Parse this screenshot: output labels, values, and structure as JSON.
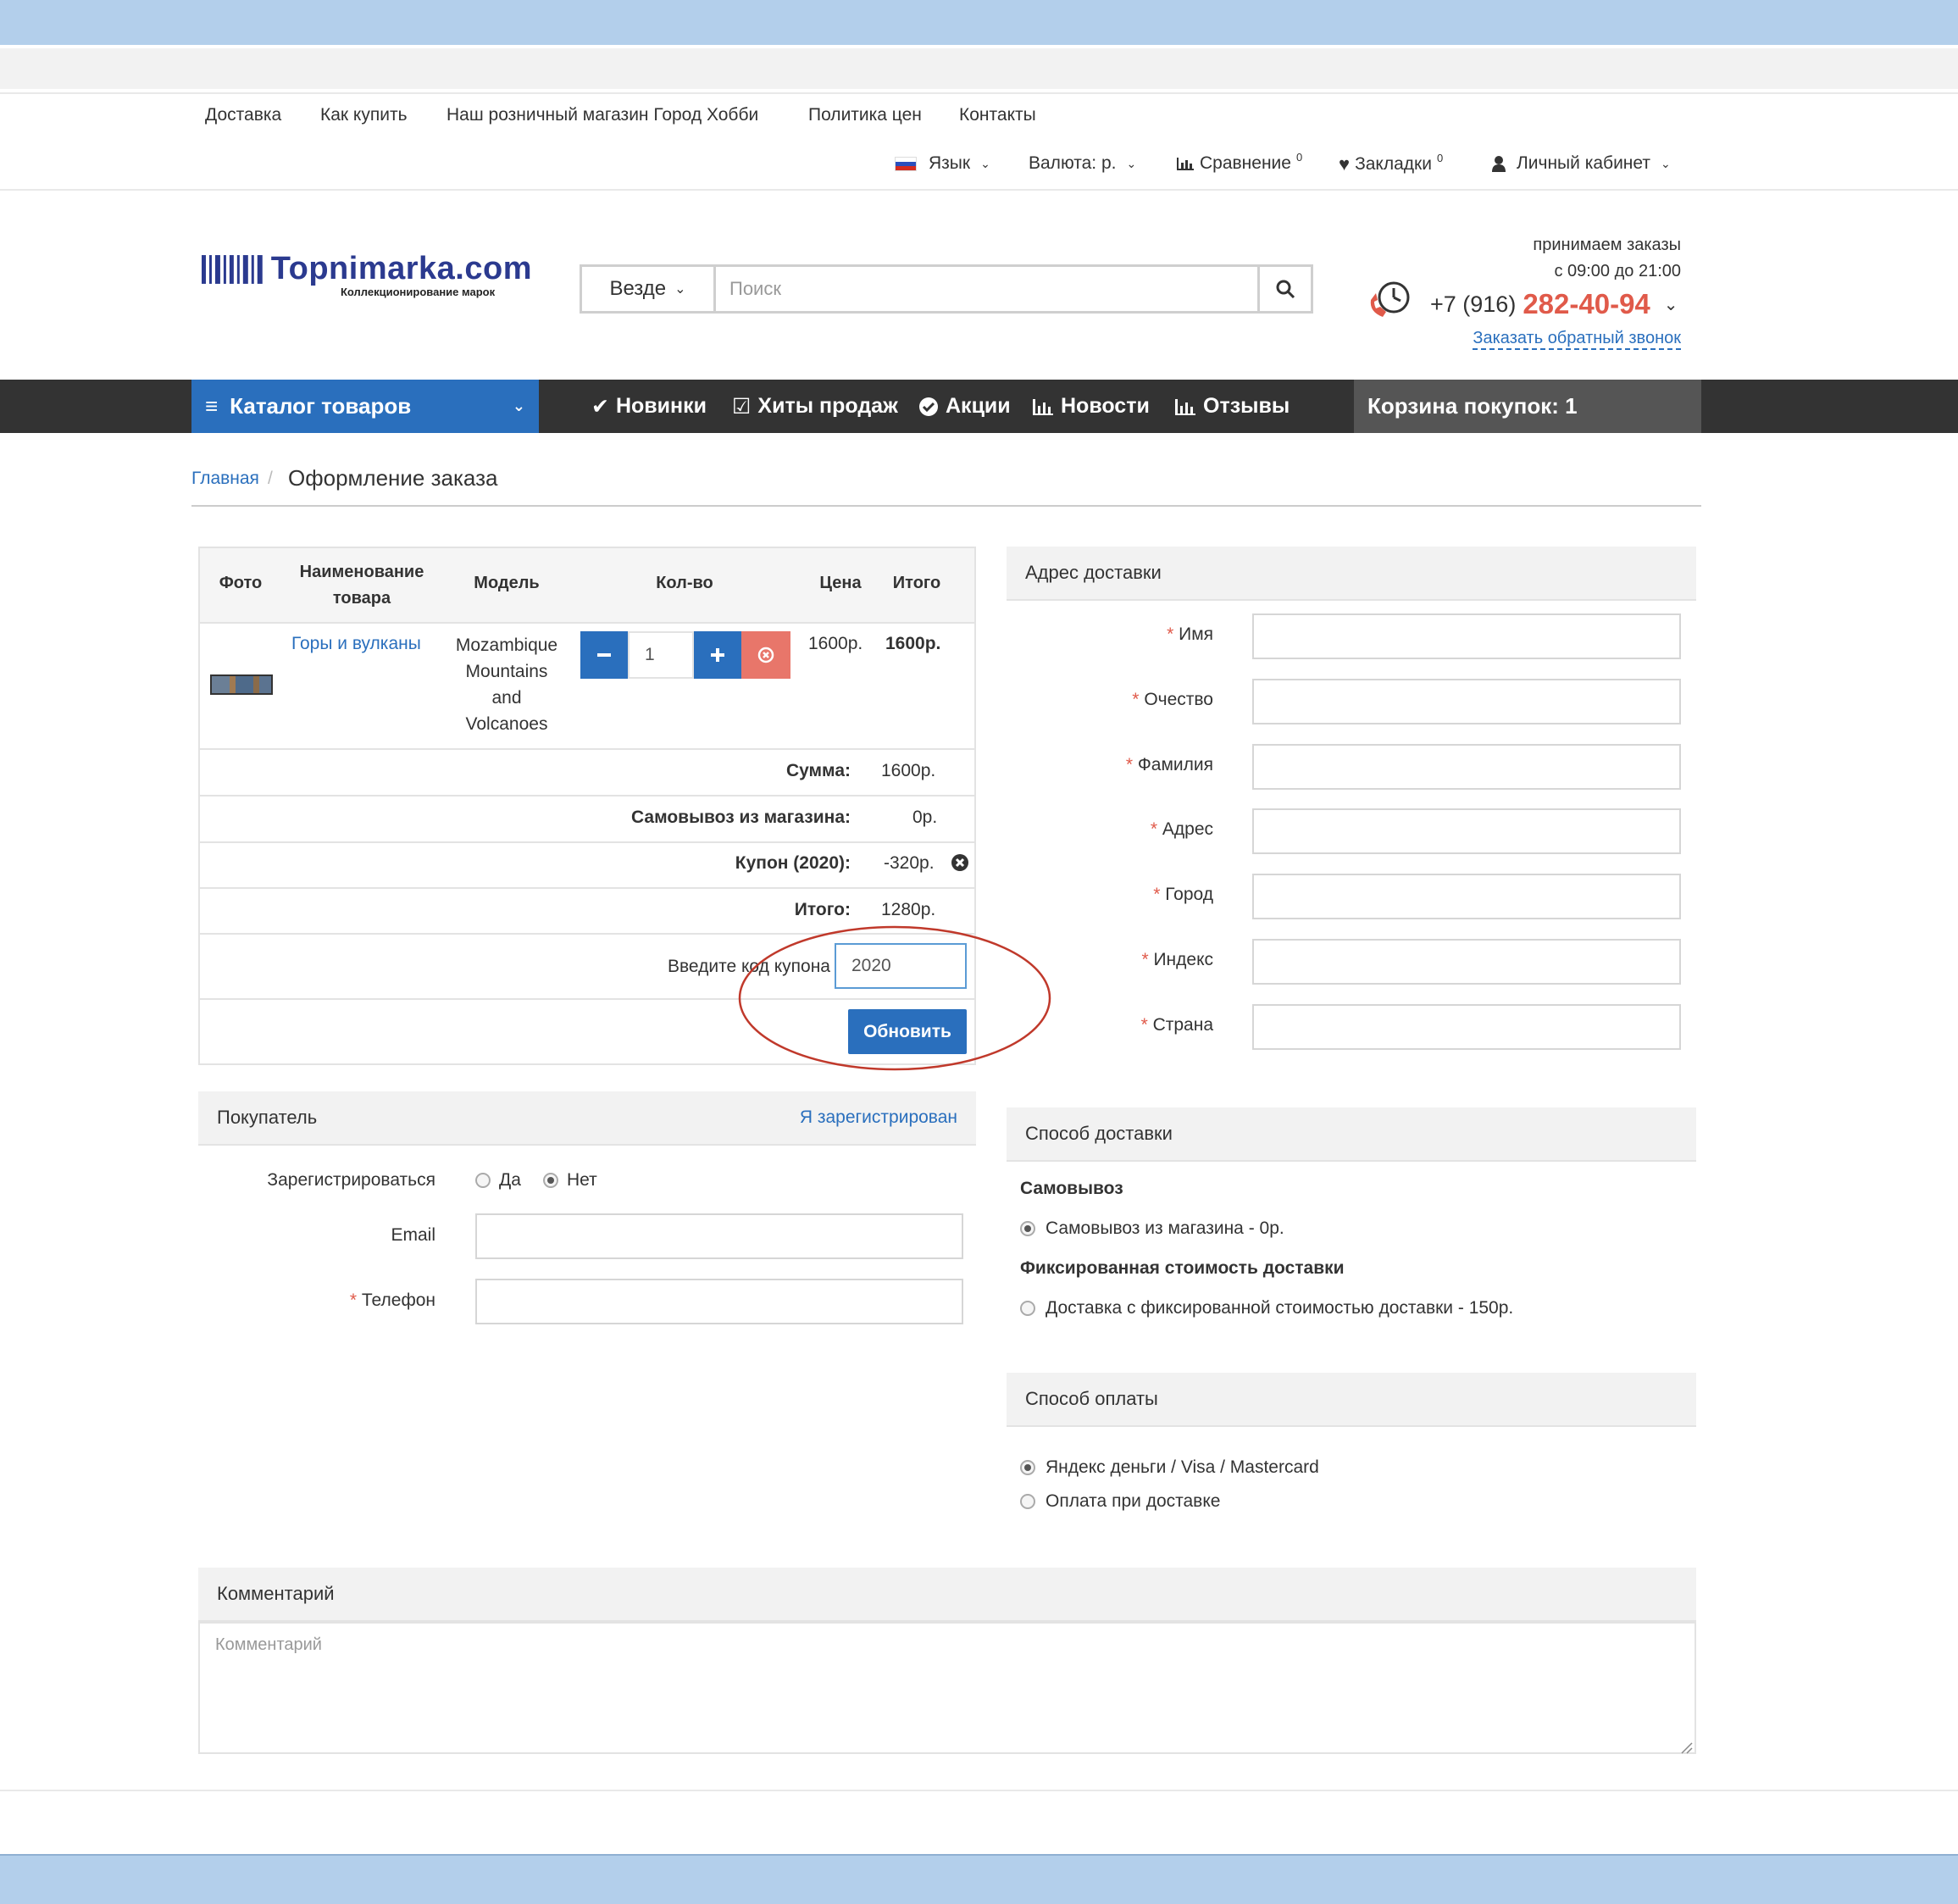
{
  "top_nav": [
    "Доставка",
    "Как купить",
    "Наш розничный магазин Город Хобби",
    "Политика цен",
    "Контакты"
  ],
  "toolbar": {
    "language": "Язык",
    "currency": "Валюта: р.",
    "compare": "Сравнение",
    "compare_count": "0",
    "bookmarks": "Закладки",
    "bookmarks_count": "0",
    "account": "Личный кабинет"
  },
  "logo": {
    "name": "Topnimarka.com",
    "tagline": "Коллекционирование марок"
  },
  "search": {
    "scope": "Везде",
    "placeholder": "Поиск"
  },
  "contact": {
    "line1": "принимаем заказы",
    "line2": "с 09:00 до 21:00",
    "phone_prefix": "+7 (916)",
    "phone_main": "282-40-94",
    "callback": "Заказать обратный звонок"
  },
  "main_nav": {
    "catalog": "Каталог товаров",
    "items": [
      "Новинки",
      "Хиты продаж",
      "Акции",
      "Новости",
      "Отзывы"
    ],
    "cart": "Корзина покупок: 1"
  },
  "breadcrumb": {
    "home": "Главная",
    "sep": "/",
    "current": "Оформление заказа"
  },
  "cart_table": {
    "headers": {
      "photo": "Фото",
      "name": "Наименование товара",
      "model": "Модель",
      "qty": "Кол-во",
      "price": "Цена",
      "total": "Итого"
    },
    "item": {
      "name": "Горы и вулканы",
      "model": "Mozambique Mountains and Volcanoes",
      "qty": "1",
      "price": "1600р.",
      "total": "1600р."
    },
    "totals": [
      {
        "label": "Сумма:",
        "value": "1600р."
      },
      {
        "label": "Самовывоз из магазина:",
        "value": "0р."
      },
      {
        "label": "Купон (2020):",
        "value": "-320р."
      },
      {
        "label": "Итого:",
        "value": "1280р."
      }
    ],
    "coupon_label": "Введите код купона",
    "coupon_value": "2020",
    "update_button": "Обновить"
  },
  "buyer": {
    "title": "Покупатель",
    "registered_link": "Я зарегистрирован",
    "register_label": "Зарегистрироваться",
    "yes": "Да",
    "no": "Нет",
    "email_label": "Email",
    "phone_label": "Телефон"
  },
  "address": {
    "title": "Адрес доставки",
    "fields": [
      "Имя",
      "Очество",
      "Фамилия",
      "Адрес",
      "Город",
      "Индекс",
      "Страна"
    ]
  },
  "shipping": {
    "title": "Способ доставки",
    "group1": "Самовывоз",
    "option1": "Самовывоз из магазина - 0р.",
    "group2": "Фиксированная стоимость доставки",
    "option2": "Доставка с фиксированной стоимостью доставки - 150р."
  },
  "payment": {
    "title": "Способ оплаты",
    "option1": "Яндекс деньги / Visa / Mastercard",
    "option2": "Оплата при доставке"
  },
  "comment": {
    "title": "Комментарий",
    "placeholder": "Комментарий"
  },
  "colors": {
    "accent": "#2a6fbd",
    "phone": "#e05a4a",
    "annotation": "#c0392b",
    "band": "#b3cfeb"
  }
}
